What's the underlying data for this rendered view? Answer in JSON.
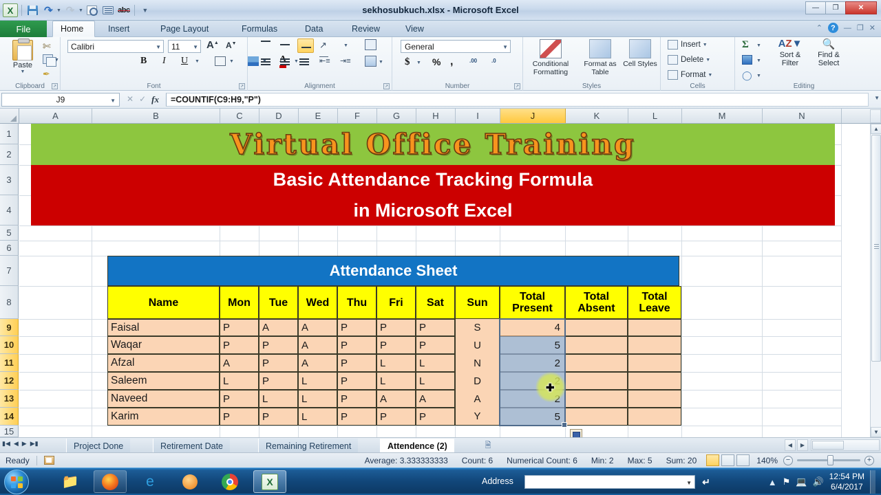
{
  "window": {
    "title": "sekhosubkuch.xlsx - Microsoft Excel",
    "minimize": "—",
    "maximize": "❐",
    "close": "✕"
  },
  "quick_access": {
    "items": [
      {
        "name": "excel-logo-icon",
        "label": "X"
      },
      {
        "name": "save-icon",
        "label": ""
      },
      {
        "name": "undo-icon",
        "label": "↶"
      },
      {
        "name": "redo-icon",
        "label": "↷"
      },
      {
        "name": "print-preview-icon",
        "label": ""
      },
      {
        "name": "email-icon",
        "label": ""
      },
      {
        "name": "spelling-icon",
        "label": "abc"
      },
      {
        "name": "customize-qat-icon",
        "label": "▾"
      }
    ]
  },
  "help_icons": [
    {
      "name": "minimize-ribbon-icon",
      "label": "⌃"
    },
    {
      "name": "help-icon",
      "label": "?"
    },
    {
      "name": "window-minimize-icon",
      "label": "—"
    },
    {
      "name": "window-restore-icon",
      "label": "❐"
    },
    {
      "name": "window-close-icon",
      "label": "✕"
    }
  ],
  "ribbon": {
    "tabs": [
      {
        "label": "File",
        "active": false
      },
      {
        "label": "Home",
        "active": true
      },
      {
        "label": "Insert",
        "active": false
      },
      {
        "label": "Page Layout",
        "active": false
      },
      {
        "label": "Formulas",
        "active": false
      },
      {
        "label": "Data",
        "active": false
      },
      {
        "label": "Review",
        "active": false
      },
      {
        "label": "View",
        "active": false
      }
    ],
    "groups": {
      "clipboard": {
        "label": "Clipboard",
        "paste": "Paste",
        "cut": "Cut",
        "copy": "Copy",
        "format_painter": "Format Painter"
      },
      "font": {
        "label": "Font",
        "font_name": "Calibri",
        "font_size": "11",
        "grow": "A",
        "shrink": "A",
        "bold": "B",
        "italic": "I",
        "underline": "U",
        "borders": "Borders",
        "fill_color": "Fill Color",
        "font_color": "A"
      },
      "alignment": {
        "label": "Alignment",
        "top_align": "Top Align",
        "middle_align": "Middle Align",
        "bottom_align": "Bottom Align",
        "orientation": "Orientation",
        "align_left": "Align Text Left",
        "center": "Center",
        "align_right": "Align Text Right",
        "decrease_indent": "Decrease Indent",
        "increase_indent": "Increase Indent",
        "wrap_text": "Wrap Text",
        "merge_center": "Merge & Center"
      },
      "number": {
        "label": "Number",
        "format": "General",
        "currency": "$",
        "percent": "%",
        "comma": ",",
        "increase_decimal": ".00",
        "decrease_decimal": ".0"
      },
      "styles": {
        "label": "Styles",
        "conditional_formatting": "Conditional Formatting",
        "format_as_table": "Format as Table",
        "cell_styles": "Cell Styles"
      },
      "cells": {
        "label": "Cells",
        "insert": "Insert",
        "delete": "Delete",
        "format": "Format"
      },
      "editing": {
        "label": "Editing",
        "autosum": "Σ",
        "fill": "Fill",
        "clear": "Clear",
        "sort_filter": "Sort & Filter",
        "find_select": "Find & Select"
      }
    }
  },
  "formula_bar": {
    "name_box": "J9",
    "cancel": "✕",
    "enter": "✓",
    "insert_function": "fx",
    "formula": "=COUNTIF(C9:H9,\"P\")"
  },
  "grid": {
    "columns": [
      "A",
      "B",
      "C",
      "D",
      "E",
      "F",
      "G",
      "H",
      "I",
      "J",
      "K",
      "L",
      "M",
      "N"
    ],
    "selected_column": "J",
    "rows": [
      "1",
      "2",
      "3",
      "4",
      "5",
      "6",
      "7",
      "8",
      "9",
      "10",
      "11",
      "12",
      "13",
      "14",
      "15"
    ],
    "selected_rows": [
      "9",
      "10",
      "11",
      "12",
      "13",
      "14"
    ],
    "banner_green": "Virtual Office Training",
    "banner_red_line1": "Basic Attendance Tracking Formula",
    "banner_red_line2": "in Microsoft Excel"
  },
  "table": {
    "title": "Attendance Sheet",
    "headers": [
      "Name",
      "Mon",
      "Tue",
      "Wed",
      "Thu",
      "Fri",
      "Sat",
      "Sun",
      "Total Present",
      "Total Absent",
      "Total Leave"
    ],
    "header_total_present_l1": "Total",
    "header_total_present_l2": "Present",
    "header_total_absent_l1": "Total",
    "header_total_absent_l2": "Absent",
    "header_total_leave_l1": "Total",
    "header_total_leave_l2": "Leave",
    "sunday_letters": [
      "S",
      "U",
      "N",
      "D",
      "A",
      "Y"
    ],
    "rows": [
      {
        "name": "Faisal",
        "days": [
          "P",
          "A",
          "A",
          "P",
          "P",
          "P"
        ],
        "sun": "S",
        "total_present": "4",
        "total_absent": "",
        "total_leave": ""
      },
      {
        "name": "Waqar",
        "days": [
          "P",
          "P",
          "A",
          "P",
          "P",
          "P"
        ],
        "sun": "U",
        "total_present": "5",
        "total_absent": "",
        "total_leave": ""
      },
      {
        "name": "Afzal",
        "days": [
          "A",
          "P",
          "A",
          "P",
          "L",
          "L"
        ],
        "sun": "N",
        "total_present": "2",
        "total_absent": "",
        "total_leave": ""
      },
      {
        "name": "Saleem",
        "days": [
          "L",
          "P",
          "L",
          "P",
          "L",
          "L"
        ],
        "sun": "D",
        "total_present": "2",
        "total_absent": "",
        "total_leave": ""
      },
      {
        "name": "Naveed",
        "days": [
          "P",
          "L",
          "L",
          "P",
          "A",
          "A"
        ],
        "sun": "A",
        "total_present": "2",
        "total_absent": "",
        "total_leave": ""
      },
      {
        "name": "Karim",
        "days": [
          "P",
          "P",
          "L",
          "P",
          "P",
          "P"
        ],
        "sun": "Y",
        "total_present": "5",
        "total_absent": "",
        "total_leave": ""
      }
    ]
  },
  "sheet_tabs": {
    "nav_first": "⏮",
    "nav_prev": "◀",
    "nav_next": "▶",
    "nav_last": "⏭",
    "tabs": [
      {
        "label": "Project Done",
        "active": false
      },
      {
        "label": "Retirement Date",
        "active": false
      },
      {
        "label": "Remaining Retirement",
        "active": false
      },
      {
        "label": "Attendence (2)",
        "active": true
      }
    ],
    "insert_worksheet": "➕"
  },
  "status_bar": {
    "mode": "Ready",
    "average": "Average: 3.333333333",
    "count": "Count: 6",
    "numerical_count": "Numerical Count: 6",
    "min": "Min: 2",
    "max": "Max: 5",
    "sum": "Sum: 20",
    "views": [
      "Normal",
      "Page Layout",
      "Page Break Preview"
    ],
    "zoom": "140%",
    "zoom_out": "−",
    "zoom_in": "+"
  },
  "taskbar": {
    "start": "Start",
    "buttons": [
      {
        "name": "windows-explorer-icon",
        "label": "Windows Explorer"
      },
      {
        "name": "firefox-icon",
        "label": "Mozilla Firefox"
      },
      {
        "name": "internet-explorer-icon",
        "label": "Internet Explorer"
      },
      {
        "name": "media-player-icon",
        "label": "Windows Media Player"
      },
      {
        "name": "chrome-icon",
        "label": "Google Chrome"
      },
      {
        "name": "excel-taskbar-icon",
        "label": "Microsoft Excel"
      }
    ],
    "address_label": "Address",
    "address_value": "",
    "go_label": "↵",
    "tray": [
      "show-hidden-icons",
      "security-icon",
      "network-icon",
      "volume-icon"
    ],
    "time": "12:54 PM",
    "date": "6/4/2017"
  },
  "colors": {
    "banner_green": "#8dc63f",
    "banner_red": "#cc0000",
    "banner_text_orange": "#f7941e",
    "table_title_blue": "#1274c4",
    "table_header_yellow": "#ffff00",
    "table_cell_peach": "#fbd5b5",
    "selection_blue": "#8ea6c4",
    "excel_green": "#1d7d3a"
  }
}
